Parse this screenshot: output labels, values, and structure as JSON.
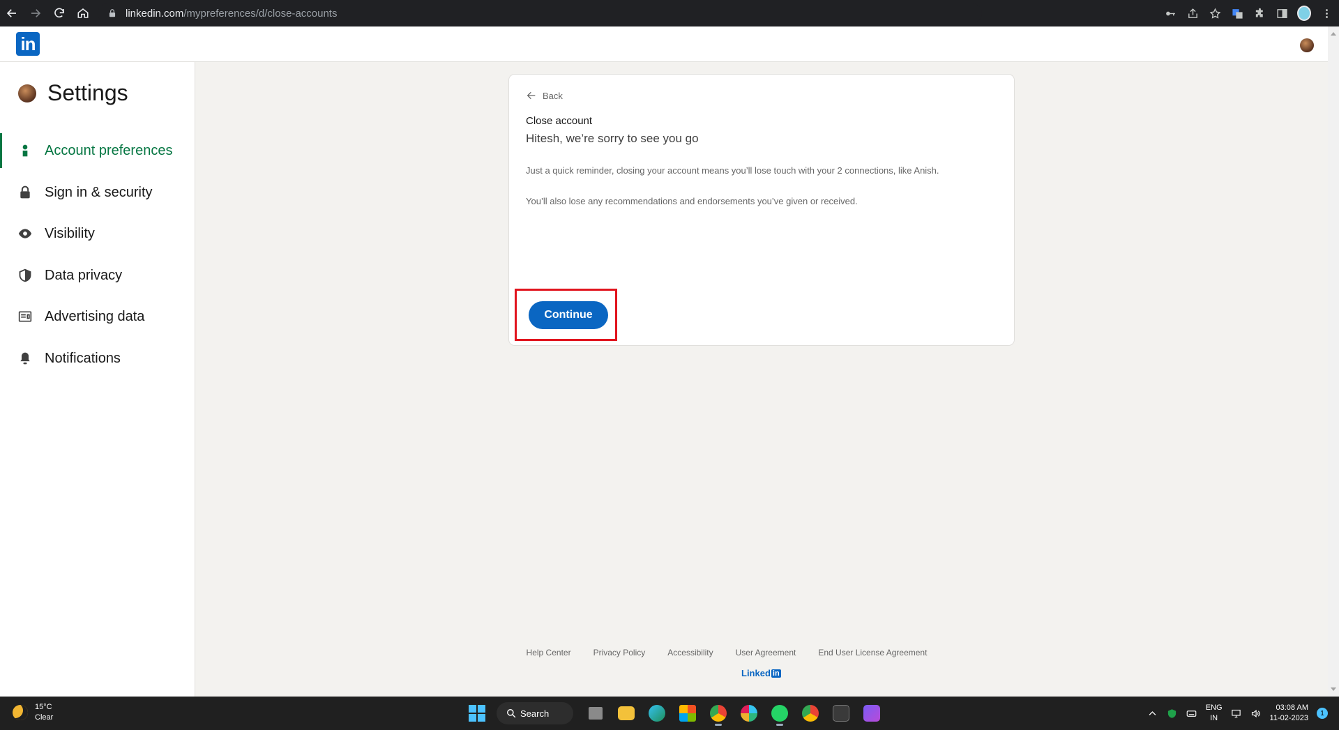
{
  "browser": {
    "url_host": "linkedin.com",
    "url_path": "/mypreferences/d/close-accounts"
  },
  "header": {
    "logo_text": "in"
  },
  "sidebar": {
    "title": "Settings",
    "items": [
      {
        "label": "Account preferences",
        "icon": "person-icon",
        "active": true
      },
      {
        "label": "Sign in & security",
        "icon": "lock-icon",
        "active": false
      },
      {
        "label": "Visibility",
        "icon": "eye-icon",
        "active": false
      },
      {
        "label": "Data privacy",
        "icon": "shield-icon",
        "active": false
      },
      {
        "label": "Advertising data",
        "icon": "ad-icon",
        "active": false
      },
      {
        "label": "Notifications",
        "icon": "bell-icon",
        "active": false
      }
    ]
  },
  "card": {
    "back_label": "Back",
    "title": "Close account",
    "heading": "Hitesh, we’re sorry to see you go",
    "paragraph1": "Just a quick reminder, closing your account means you’ll lose touch with your 2 connections, like Anish.",
    "paragraph2": "You’ll also lose any recommendations and endorsements you’ve given or received.",
    "continue_label": "Continue"
  },
  "footer": {
    "links": [
      "Help Center",
      "Privacy Policy",
      "Accessibility",
      "User Agreement",
      "End User License Agreement"
    ],
    "logo_text": "Linked",
    "logo_in": "in"
  },
  "taskbar": {
    "temperature": "15°C",
    "condition": "Clear",
    "search_label": "Search",
    "lang_top": "ENG",
    "lang_bottom": "IN",
    "time": "03:08 AM",
    "date": "11-02-2023",
    "notification_count": "1"
  },
  "colors": {
    "linkedin_blue": "#0a66c2",
    "active_green": "#057642",
    "highlight_red": "#e1141e"
  }
}
